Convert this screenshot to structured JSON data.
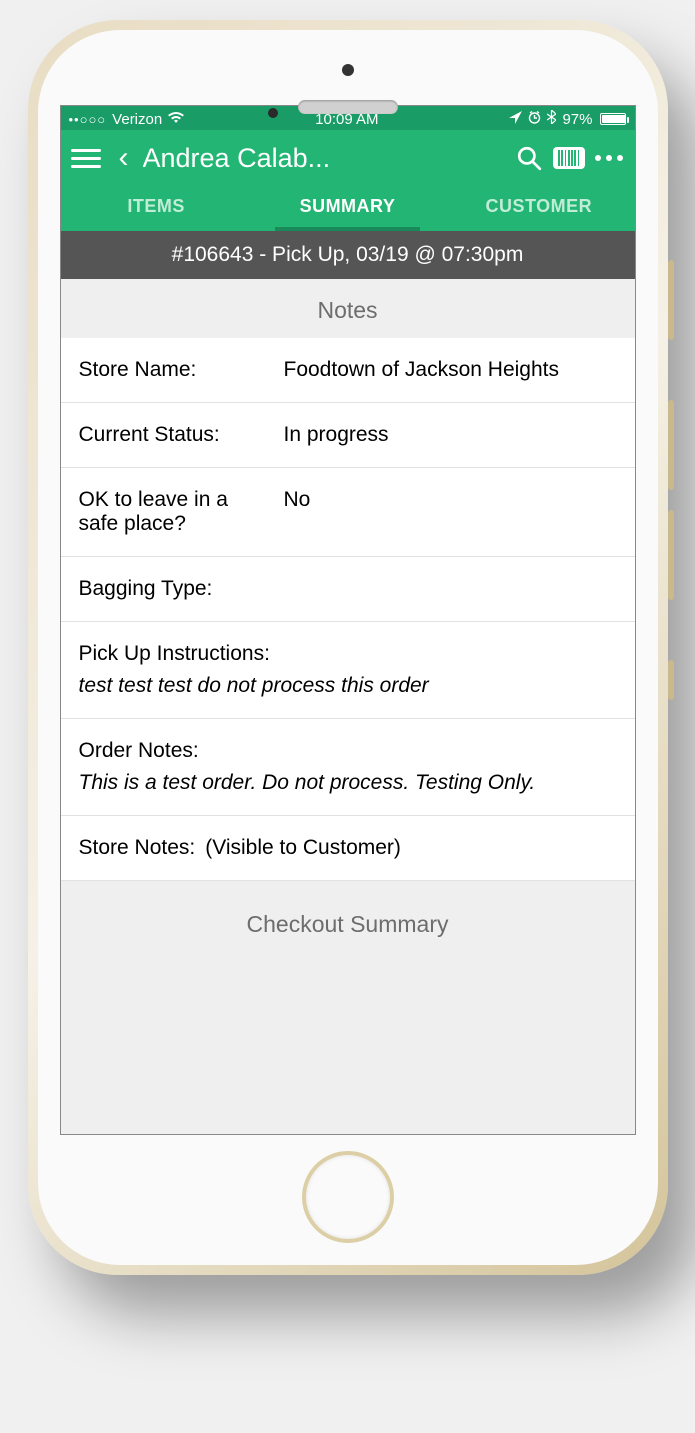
{
  "statusbar": {
    "signal_dots": "••○○○",
    "carrier": "Verizon",
    "time": "10:09 AM",
    "battery_pct": "97%",
    "battery_fill_pct": 97
  },
  "navbar": {
    "title": "Andrea Calab..."
  },
  "tabs": {
    "items": "ITEMS",
    "summary": "SUMMARY",
    "customer": "CUSTOMER"
  },
  "orderbar": "#106643 - Pick Up, 03/19 @ 07:30pm",
  "sections": {
    "notes_header": "Notes",
    "checkout_header": "Checkout Summary"
  },
  "fields": {
    "store_name_label": "Store Name:",
    "store_name_value": "Foodtown of Jackson Heights",
    "status_label": "Current Status:",
    "status_value": "In progress",
    "ok_leave_label": "OK to leave in a safe place?",
    "ok_leave_value": "No",
    "bagging_label": "Bagging Type:",
    "bagging_value": "",
    "pickup_instr_label": "Pick Up Instructions:",
    "pickup_instr_value": "test test test do not process this order",
    "order_notes_label": "Order Notes:",
    "order_notes_value": "This is a test order. Do not process. Testing Only.",
    "store_notes_label": "Store Notes:",
    "store_notes_hint": "(Visible to Customer)"
  }
}
